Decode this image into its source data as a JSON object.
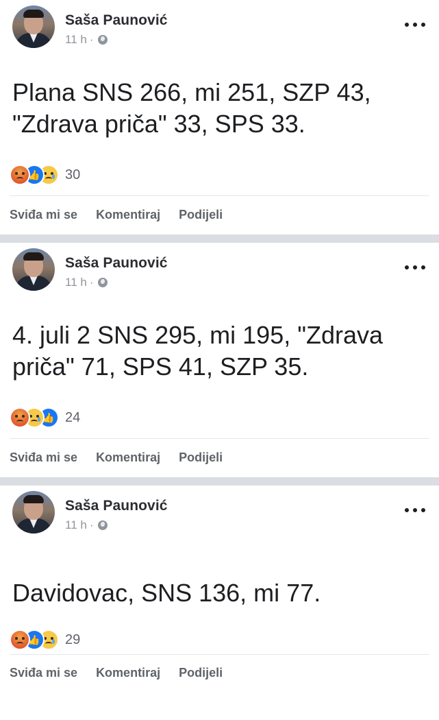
{
  "posts": [
    {
      "author": "Saša Paunović",
      "time": "11 h",
      "text": "Plana SNS 266, mi 251, SZP 43, \"Zdrava priča\" 33, SPS 33.",
      "reactions": [
        "angry",
        "like",
        "sad"
      ],
      "reaction_count": "30"
    },
    {
      "author": "Saša Paunović",
      "time": "11 h",
      "text": "4. juli 2 SNS 295, mi 195, \"Zdrava priča\" 71, SPS 41, SZP 35.",
      "reactions": [
        "angry",
        "sad",
        "like"
      ],
      "reaction_count": "24"
    },
    {
      "author": "Saša Paunović",
      "time": "11 h",
      "text": "Davidovac, SNS 136, mi 77.",
      "reactions": [
        "angry",
        "like",
        "sad"
      ],
      "reaction_count": "29"
    }
  ],
  "actions": {
    "like_label": "Sviđa mi se",
    "comment_label": "Komentiraj",
    "share_label": "Podijeli"
  },
  "colors": {
    "separator": "#dadde1",
    "like_blue": "#1877f2",
    "meta_gray": "#90949c"
  }
}
